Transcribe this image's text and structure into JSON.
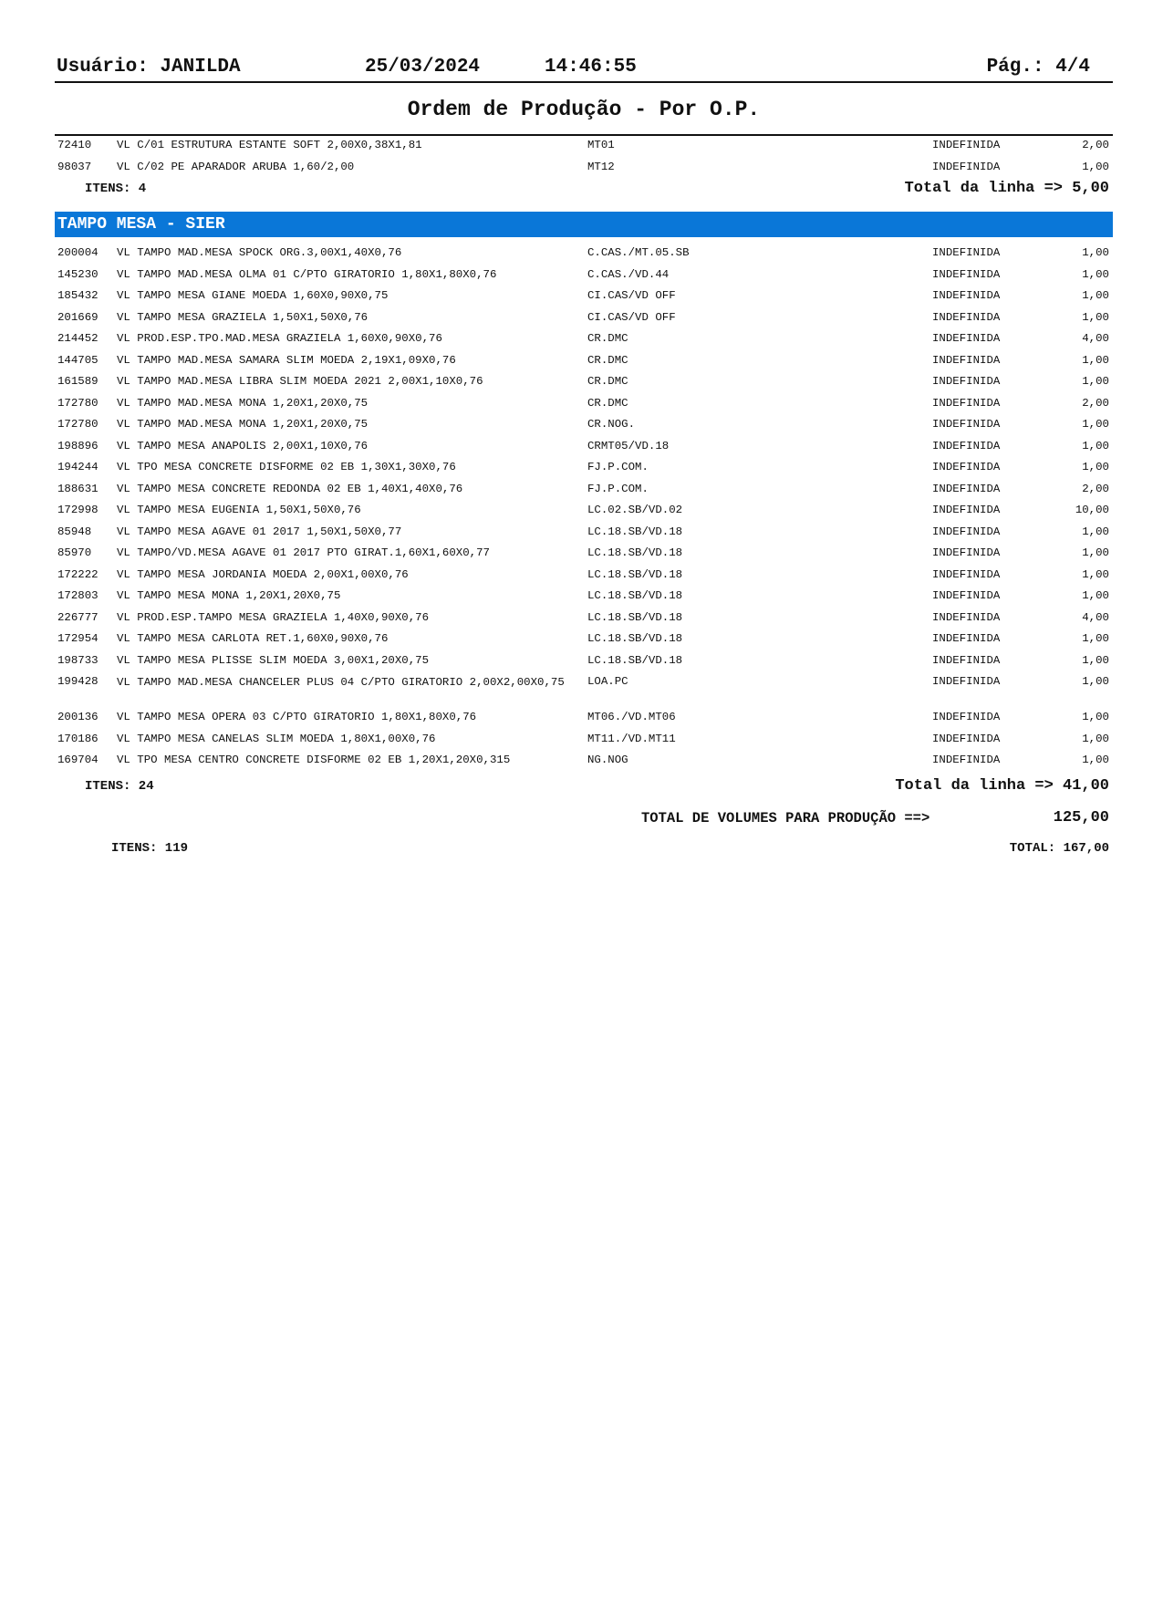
{
  "header": {
    "user": "Usuário: JANILDA",
    "date": "25/03/2024",
    "time": "14:46:55",
    "page": "Pág.:  4/4"
  },
  "title": "Ordem de Produção - Por O.P.",
  "first_block": {
    "rows": [
      {
        "code": "72410",
        "desc": "VL C/01 ESTRUTURA ESTANTE SOFT 2,00X0,38X1,81",
        "loc": "MT01",
        "status": "INDEFINIDA",
        "qty": "2,00"
      },
      {
        "code": "98037",
        "desc": "VL C/02 PE APARADOR ARUBA 1,60/2,00",
        "loc": "MT12",
        "status": "INDEFINIDA",
        "qty": "1,00"
      }
    ],
    "items": "ITENS: 4",
    "total": "Total da linha => 5,00"
  },
  "group": {
    "title": "TAMPO MESA - SIER",
    "rows": [
      {
        "code": "200004",
        "desc": "VL TAMPO MAD.MESA SPOCK ORG.3,00X1,40X0,76",
        "loc": "C.CAS./MT.05.SB",
        "status": "INDEFINIDA",
        "qty": "1,00"
      },
      {
        "code": "145230",
        "desc": "VL TAMPO MAD.MESA OLMA 01 C/PTO GIRATORIO 1,80X1,80X0,76",
        "loc": "C.CAS./VD.44",
        "status": "INDEFINIDA",
        "qty": "1,00"
      },
      {
        "code": "185432",
        "desc": "VL TAMPO MESA GIANE MOEDA 1,60X0,90X0,75",
        "loc": "CI.CAS/VD OFF",
        "status": "INDEFINIDA",
        "qty": "1,00"
      },
      {
        "code": "201669",
        "desc": "VL TAMPO MESA GRAZIELA 1,50X1,50X0,76",
        "loc": "CI.CAS/VD OFF",
        "status": "INDEFINIDA",
        "qty": "1,00"
      },
      {
        "code": "214452",
        "desc": "VL PROD.ESP.TPO.MAD.MESA GRAZIELA 1,60X0,90X0,76",
        "loc": "CR.DMC",
        "status": "INDEFINIDA",
        "qty": "4,00"
      },
      {
        "code": "144705",
        "desc": "VL TAMPO MAD.MESA SAMARA SLIM MOEDA 2,19X1,09X0,76",
        "loc": "CR.DMC",
        "status": "INDEFINIDA",
        "qty": "1,00"
      },
      {
        "code": "161589",
        "desc": "VL TAMPO MAD.MESA LIBRA SLIM MOEDA 2021 2,00X1,10X0,76",
        "loc": "CR.DMC",
        "status": "INDEFINIDA",
        "qty": "1,00"
      },
      {
        "code": "172780",
        "desc": "VL TAMPO MAD.MESA MONA 1,20X1,20X0,75",
        "loc": "CR.DMC",
        "status": "INDEFINIDA",
        "qty": "2,00"
      },
      {
        "code": "172780",
        "desc": "VL TAMPO MAD.MESA MONA 1,20X1,20X0,75",
        "loc": "CR.NOG.",
        "status": "INDEFINIDA",
        "qty": "1,00"
      },
      {
        "code": "198896",
        "desc": "VL TAMPO MESA ANAPOLIS 2,00X1,10X0,76",
        "loc": "CRMT05/VD.18",
        "status": "INDEFINIDA",
        "qty": "1,00"
      },
      {
        "code": "194244",
        "desc": "VL TPO MESA CONCRETE DISFORME 02 EB 1,30X1,30X0,76",
        "loc": "FJ.P.COM.",
        "status": "INDEFINIDA",
        "qty": "1,00"
      },
      {
        "code": "188631",
        "desc": "VL TAMPO MESA CONCRETE REDONDA 02 EB 1,40X1,40X0,76",
        "loc": "FJ.P.COM.",
        "status": "INDEFINIDA",
        "qty": "2,00"
      },
      {
        "code": "172998",
        "desc": "VL TAMPO MESA EUGENIA 1,50X1,50X0,76",
        "loc": "LC.02.SB/VD.02",
        "status": "INDEFINIDA",
        "qty": "10,00"
      },
      {
        "code": "85948",
        "desc": "VL TAMPO MESA AGAVE 01 2017 1,50X1,50X0,77",
        "loc": "LC.18.SB/VD.18",
        "status": "INDEFINIDA",
        "qty": "1,00"
      },
      {
        "code": "85970",
        "desc": "VL TAMPO/VD.MESA AGAVE 01 2017 PTO GIRAT.1,60X1,60X0,77",
        "loc": "LC.18.SB/VD.18",
        "status": "INDEFINIDA",
        "qty": "1,00"
      },
      {
        "code": "172222",
        "desc": "VL TAMPO MESA JORDANIA MOEDA 2,00X1,00X0,76",
        "loc": "LC.18.SB/VD.18",
        "status": "INDEFINIDA",
        "qty": "1,00"
      },
      {
        "code": "172803",
        "desc": "VL TAMPO MESA MONA 1,20X1,20X0,75",
        "loc": "LC.18.SB/VD.18",
        "status": "INDEFINIDA",
        "qty": "1,00"
      },
      {
        "code": "226777",
        "desc": "VL PROD.ESP.TAMPO MESA GRAZIELA 1,40X0,90X0,76",
        "loc": "LC.18.SB/VD.18",
        "status": "INDEFINIDA",
        "qty": "4,00"
      },
      {
        "code": "172954",
        "desc": "VL TAMPO MESA CARLOTA RET.1,60X0,90X0,76",
        "loc": "LC.18.SB/VD.18",
        "status": "INDEFINIDA",
        "qty": "1,00"
      },
      {
        "code": "198733",
        "desc": "VL TAMPO MESA PLISSE SLIM MOEDA 3,00X1,20X0,75",
        "loc": "LC.18.SB/VD.18",
        "status": "INDEFINIDA",
        "qty": "1,00"
      },
      {
        "code": "199428",
        "desc": "VL TAMPO MAD.MESA CHANCELER PLUS 04 C/PTO GIRATORIO 2,00X2,00X0,75",
        "loc": "LOA.PC",
        "status": "INDEFINIDA",
        "qty": "1,00",
        "wrap": true
      },
      {
        "code": "200136",
        "desc": "VL TAMPO MESA OPERA 03 C/PTO GIRATORIO 1,80X1,80X0,76",
        "loc": "MT06./VD.MT06",
        "status": "INDEFINIDA",
        "qty": "1,00"
      },
      {
        "code": "170186",
        "desc": "VL TAMPO MESA CANELAS SLIM MOEDA 1,80X1,00X0,76",
        "loc": "MT11./VD.MT11",
        "status": "INDEFINIDA",
        "qty": "1,00"
      },
      {
        "code": "169704",
        "desc": "VL TPO MESA CENTRO CONCRETE DISFORME 02 EB 1,20X1,20X0,315",
        "loc": "NG.NOG",
        "status": "INDEFINIDA",
        "qty": "1,00"
      }
    ],
    "items": "ITENS: 24",
    "total": "Total da linha => 41,00"
  },
  "totals": {
    "volumes_label": "TOTAL DE VOLUMES PARA PRODUÇÃO ==>",
    "volumes_value": "125,00",
    "items": "ITENS: 119",
    "total": "TOTAL: 167,00"
  }
}
